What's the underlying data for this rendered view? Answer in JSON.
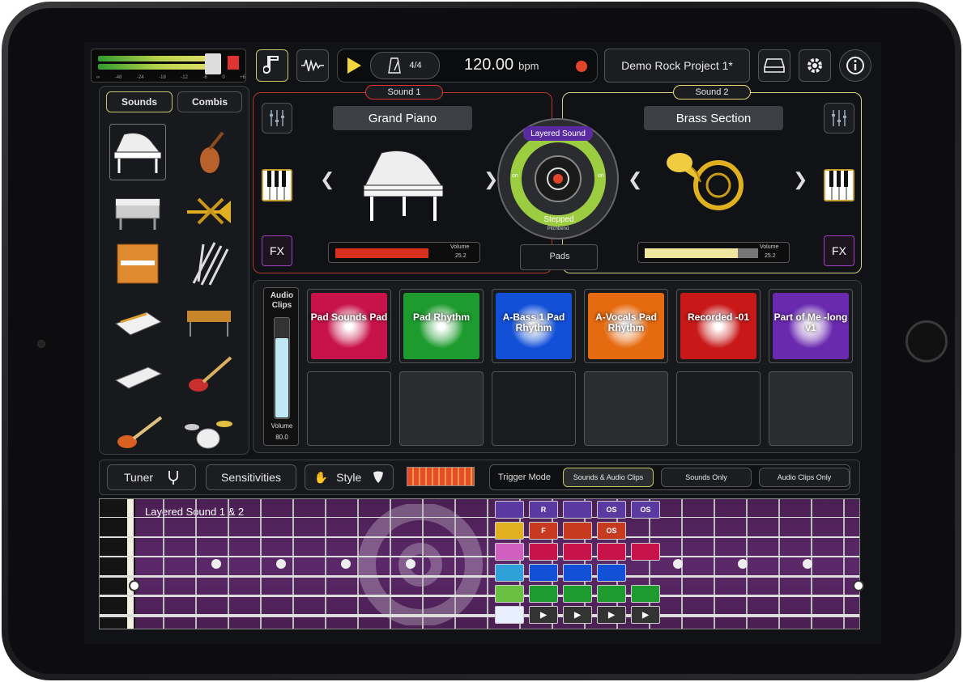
{
  "topbar": {
    "meter_ticks": [
      "∞",
      "-48",
      "-24",
      "-18",
      "-12",
      "-6",
      "0",
      "+6"
    ],
    "time_signature": "4/4",
    "tempo": "120.00",
    "tempo_unit": "bpm",
    "project_name": "Demo Rock Project 1*"
  },
  "sidebar": {
    "tabs": [
      {
        "label": "Sounds"
      },
      {
        "label": "Combis"
      }
    ],
    "instruments": [
      "grand-piano",
      "violin",
      "electric-piano",
      "trumpet",
      "organ",
      "woodwinds",
      "synthesizer",
      "marimba",
      "keyboard",
      "electric-guitar",
      "bass-guitar",
      "drum-kit"
    ]
  },
  "sound1": {
    "tag": "Sound 1",
    "name": "Grand Piano",
    "volume_label": "Volume",
    "volume_value": "25.2",
    "volume_level": 0.82,
    "color": "#d8301f",
    "fx": "FX"
  },
  "sound2": {
    "tag": "Sound 2",
    "name": "Brass Section",
    "volume_label": "Volume",
    "volume_value": "25.2",
    "volume_level": 0.82,
    "color": "#f0e6a0",
    "fx": "FX"
  },
  "layer": {
    "top": "Layered Sound",
    "bottom": "Stepped",
    "sub": "Pitchbend",
    "left_on": "on",
    "right_on": "on",
    "pads_label": "Pads"
  },
  "clips": {
    "title": "Audio Clips",
    "volume_label": "Volume",
    "volume_value": "80.0",
    "volume_level": 0.8,
    "pads": [
      {
        "label": "Pad Sounds Pad",
        "color": "#c8124a"
      },
      {
        "label": "Pad Rhythm",
        "color": "#1e9b2e"
      },
      {
        "label": "A-Bass 1 Pad Rhythm",
        "color": "#1250d8"
      },
      {
        "label": "A-Vocals Pad Rhythm",
        "color": "#e66a10"
      },
      {
        "label": "Recorded -01",
        "color": "#c81818"
      },
      {
        "label": "Part of Me -long v1",
        "color": "#6a2ab0"
      }
    ]
  },
  "toolbar": {
    "tuner": "Tuner",
    "sensitivities": "Sensitivities",
    "style": "Style",
    "trigger_mode": "Trigger Mode",
    "modes": [
      {
        "label": "Sounds & Audio Clips",
        "active": true
      },
      {
        "label": "Sounds Only",
        "active": false
      },
      {
        "label": "Audio Clips Only",
        "active": false
      }
    ]
  },
  "fretboard": {
    "label": "Layered Sound 1 & 2",
    "grid_labels": [
      "R",
      "OS",
      "OS",
      "F",
      "OS"
    ]
  }
}
